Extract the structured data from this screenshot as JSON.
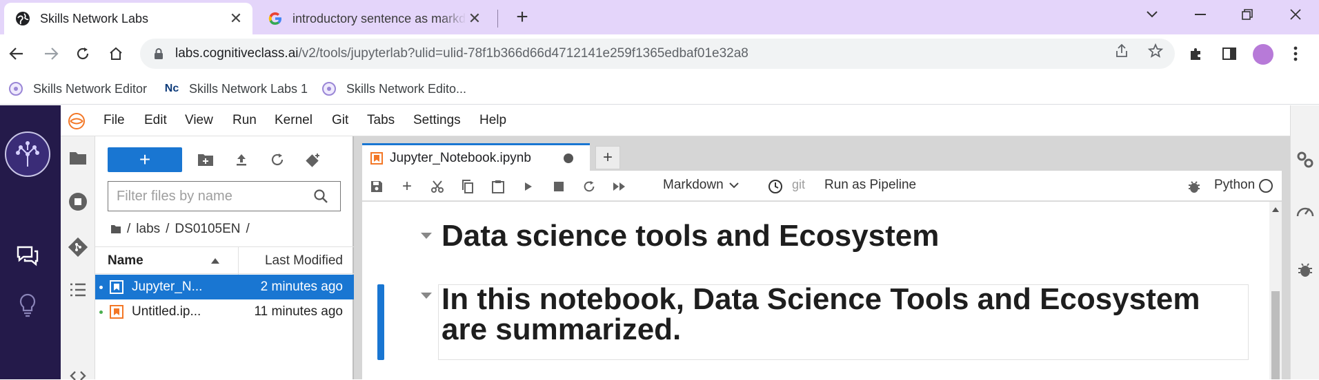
{
  "browser": {
    "tabs": [
      {
        "title": "Skills Network Labs",
        "active": true
      },
      {
        "title": "introductory sentence as markdown",
        "active": false
      }
    ],
    "url_host": "labs.cognitiveclass.ai",
    "url_path": "/v2/tools/jupyterlab?ulid=ulid-78f1b366d66d4712141e259f1365edbaf01e32a8",
    "bookmarks": [
      {
        "label": "Skills Network Editor"
      },
      {
        "label": "Skills Network Labs 1"
      },
      {
        "label": "Skills Network Edito..."
      }
    ]
  },
  "menu": [
    "File",
    "Edit",
    "View",
    "Run",
    "Kernel",
    "Git",
    "Tabs",
    "Settings",
    "Help"
  ],
  "filebrowser": {
    "new_label": "+",
    "filter_placeholder": "Filter files by name",
    "breadcrumb": [
      "labs",
      "DS0105EN"
    ],
    "col_name": "Name",
    "col_modified": "Last Modified",
    "files": [
      {
        "name": "Jupyter_N...",
        "modified": "2 minutes ago",
        "selected": true
      },
      {
        "name": "Untitled.ip...",
        "modified": "11 minutes ago",
        "selected": false
      }
    ]
  },
  "notebook": {
    "tab_title": "Jupyter_Notebook.ipynb",
    "cell_type": "Markdown",
    "git_label": "git",
    "pipeline_label": "Run as Pipeline",
    "kernel": "Python",
    "cells": [
      {
        "text": "Data science tools and Ecosystem"
      },
      {
        "text": "In this notebook, Data Science Tools and Ecosystem are summarized."
      }
    ]
  },
  "colors": {
    "tabstrip": "#e4d5fa",
    "rail": "#241a4a",
    "accent": "#1976d2"
  },
  "icons": [
    "globe-icon",
    "google-icon",
    "close-icon",
    "new-tab-icon",
    "back-icon",
    "forward-icon",
    "reload-icon",
    "home-icon",
    "lock-icon",
    "share-icon",
    "star-icon",
    "extensions-icon",
    "sidepanel-icon",
    "menu-dots-icon"
  ]
}
